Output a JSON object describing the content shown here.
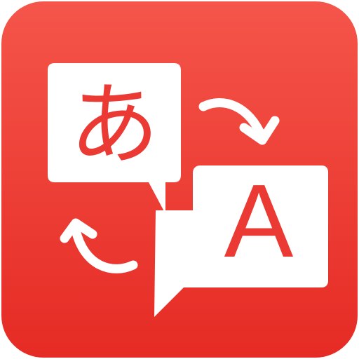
{
  "icon": {
    "name": "translate-app-icon",
    "source_char": "あ",
    "target_char": "A",
    "colors": {
      "gradient_top": "#F5554A",
      "gradient_bottom": "#E52B24",
      "bubble": "#FFFFFF",
      "glyph": "#EA3A33",
      "arrow": "#FFFFFF"
    }
  }
}
